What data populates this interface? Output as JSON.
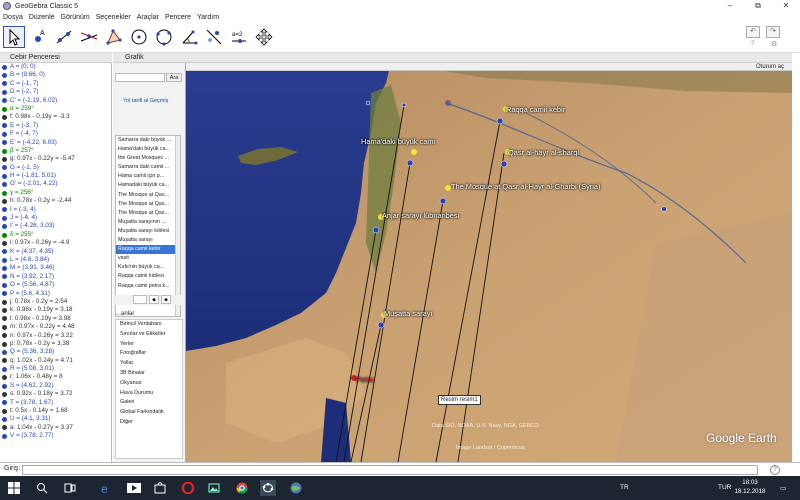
{
  "window": {
    "title": "GeoGebra Classic 5",
    "minimize": "–",
    "maximize": "⧉",
    "close": "✕"
  },
  "menu": [
    "Dosya",
    "Düzenle",
    "Görünüm",
    "Seçenekler",
    "Araçlar",
    "Pencere",
    "Yardım"
  ],
  "toolbar": {
    "slider_label": "a=2",
    "undo": "↶",
    "redo": "↷",
    "help": "?",
    "settings": "⚙"
  },
  "algebra": {
    "title": "Cebir Penceresi",
    "items": [
      {
        "text": "A = (0, 0)",
        "color": "#2946b9"
      },
      {
        "text": "B = (9.66, 0)",
        "color": "#2946b9"
      },
      {
        "text": "C = (-1, 7)",
        "color": "#2946b9"
      },
      {
        "text": "D = (-2, 7)",
        "color": "#2946b9"
      },
      {
        "text": "C' = (-2.19, 6.02)",
        "color": "#2946b9"
      },
      {
        "text": "α = 259°",
        "color": "#008a00"
      },
      {
        "text": "f: 0.98x - 0.19y = -3.3",
        "color": "#333333"
      },
      {
        "text": "E = (-3, 7)",
        "color": "#2946b9"
      },
      {
        "text": "F = (-4, 7)",
        "color": "#2946b9"
      },
      {
        "text": "E' = (-4.22, 6.03)",
        "color": "#2946b9"
      },
      {
        "text": "β = 257°",
        "color": "#008a00"
      },
      {
        "text": "g: 0.97x - 0.22y = -5.47",
        "color": "#333333"
      },
      {
        "text": "G = (-1, 5)",
        "color": "#2946b9"
      },
      {
        "text": "H = (-1.81, 5.01)",
        "color": "#2946b9"
      },
      {
        "text": "G' = (-2.01, 4.22)",
        "color": "#2946b9"
      },
      {
        "text": "γ = 256°",
        "color": "#008a00"
      },
      {
        "text": "h: 0.78x - 0.2y = -2.44",
        "color": "#333333"
      },
      {
        "text": "I = (-3, 4)",
        "color": "#2946b9"
      },
      {
        "text": "J = (-4, 4)",
        "color": "#2946b9"
      },
      {
        "text": "I' = (-4.26, 3.03)",
        "color": "#2946b9"
      },
      {
        "text": "δ = 255°",
        "color": "#008a00"
      },
      {
        "text": "i: 0.97x - 0.26y = -4.9",
        "color": "#333333"
      },
      {
        "text": "K = (4.37, 4.35)",
        "color": "#2946b9"
      },
      {
        "text": "L = (4.8, 3.84)",
        "color": "#2946b9"
      },
      {
        "text": "M = (3.91, 3.46)",
        "color": "#2946b9"
      },
      {
        "text": "N = (3.92, 2.17)",
        "color": "#2946b9"
      },
      {
        "text": "O = (5.56, 4.87)",
        "color": "#2946b9"
      },
      {
        "text": "P = (5.6, 4.31)",
        "color": "#2946b9"
      },
      {
        "text": "j: 0.78x - 0.2y = 2.54",
        "color": "#333333"
      },
      {
        "text": "k: 0.98x - 0.19y = 3.18",
        "color": "#333333"
      },
      {
        "text": "l: 0.98x - 0.19y = 3.98",
        "color": "#333333"
      },
      {
        "text": "m: 0.97x - 0.22y = 4.48",
        "color": "#333333"
      },
      {
        "text": "n: 0.97x - 0.26y = 3.22",
        "color": "#333333"
      },
      {
        "text": "p: 0.78x - 0.2y = 3.38",
        "color": "#333333"
      },
      {
        "text": "Q = (5.36, 3.28)",
        "color": "#2946b9"
      },
      {
        "text": "q: 1.02x - 0.24y = 4.71",
        "color": "#333333"
      },
      {
        "text": "R = (5.08, 3.01)",
        "color": "#2946b9"
      },
      {
        "text": "r: 1.06x - 0.48y = 8",
        "color": "#333333"
      },
      {
        "text": "S = (4.62, 2.92)",
        "color": "#2946b9"
      },
      {
        "text": "s: 0.92x - 0.18y = 3.72",
        "color": "#333333"
      },
      {
        "text": "T = (3.78, 1.67)",
        "color": "#2946b9"
      },
      {
        "text": "t: 0.5x - 0.14y = 1.68",
        "color": "#333333"
      },
      {
        "text": "U = (4.1, 3.31)",
        "color": "#2946b9"
      },
      {
        "text": "a: 1.04x - 0.27y = 3.37",
        "color": "#333333"
      },
      {
        "text": "V = (3.78, 2.77)",
        "color": "#2946b9"
      }
    ]
  },
  "graphics": {
    "title": "Grafik"
  },
  "earth": {
    "search_button": "Ara",
    "links": "Yol tarifi al   Geçmiş",
    "places": [
      "Samarra daki büyük ...",
      "Hama'daki büyük ca...",
      "the Great Mosques ...",
      "Samarra daki camii ...",
      "Hama camii için p...",
      "Hamadaki büyük ca...",
      "The Mosque at Qas...",
      "The Mosque at Qas...",
      "The Mosque at Qas...",
      "Muşatta sarayının ...",
      "Muşatta sarayı kıblesi",
      "Muşatta sarayı",
      "Raqqa camii kebir",
      "vasit",
      "Kufe'nin büyük ca...",
      "Raqqa camii kıblesi",
      "Raqqa camii petra k..."
    ],
    "selected_index": 12,
    "layers_title": "...anlar",
    "layers": [
      "Birincil Veritabanı",
      "Sınırlar ve Etiketler",
      "Yerler",
      "Fotoğraflar",
      "Yollar",
      "3B Binalar",
      "Okyanus",
      "Hava Durumu",
      "Galeri",
      "Global Farkındalık",
      "Diğer"
    ],
    "signin": "Oturum aç",
    "map_labels": [
      "Raqqa camii kebir",
      "Hama'daki büyük cami",
      "Qasr al-hayr al-sharqi",
      "The Mosque at Qasr al-Hayr al-Gharbi (Syria)",
      "Anjar sarayı lübnanbesi",
      "Muşatta sarayı",
      "Petra"
    ],
    "resim_label": "Resim resim1",
    "brand": "Google Earth",
    "credits": "Data SIO, NOAA, U.S. Navy, NGA, GEBCO",
    "credits2": "Image Landsat / Copernicus"
  },
  "input": {
    "label": "Giriş:"
  },
  "taskbar": {
    "lang": "TR",
    "lang2": "TUR",
    "time": "18:03",
    "date": "18.12.2018"
  }
}
